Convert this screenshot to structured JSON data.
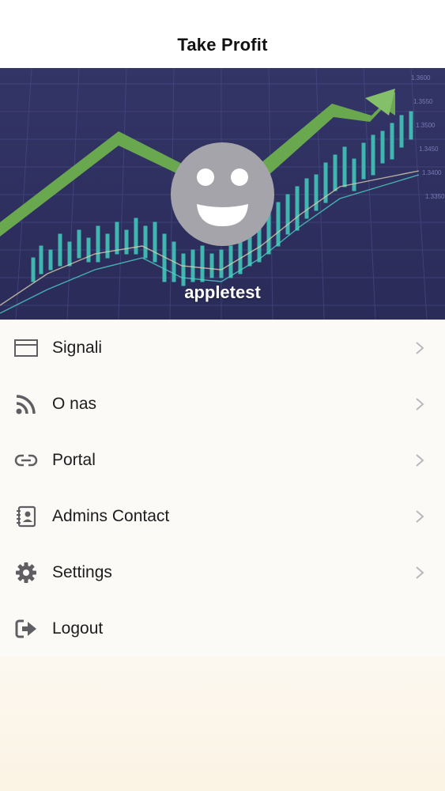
{
  "header": {
    "title": "Take Profit"
  },
  "profile": {
    "username": "appletest"
  },
  "menu": {
    "items": [
      {
        "label": "Signali",
        "icon": "card-icon",
        "has_chevron": true
      },
      {
        "label": "O nas",
        "icon": "rss-icon",
        "has_chevron": true
      },
      {
        "label": "Portal",
        "icon": "link-icon",
        "has_chevron": true
      },
      {
        "label": "Admins Contact",
        "icon": "contacts-book-icon",
        "has_chevron": true
      },
      {
        "label": "Settings",
        "icon": "gear-icon",
        "has_chevron": true
      },
      {
        "label": "Logout",
        "icon": "logout-icon",
        "has_chevron": false
      }
    ]
  },
  "colors": {
    "hero_background": "#2f3062",
    "arrow_green": "#6aa84f",
    "icon_gray": "#5f5f63",
    "chevron_gray": "#b8b8bd"
  }
}
